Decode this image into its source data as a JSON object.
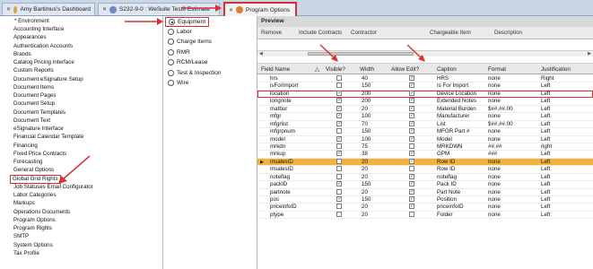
{
  "tabs": [
    {
      "label": "Amy Bartimus's Dashboard",
      "close": "✕",
      "icon": "dashboard-icon",
      "color": "#d9a441"
    },
    {
      "label": "S232-9-0 : WeSuite Test9 Estimate",
      "close": "✕",
      "icon": "estimate-icon",
      "color": "#6b8cc7"
    },
    {
      "label": "Program Options",
      "close": "✕",
      "icon": "gear-icon",
      "color": "#e07a2e"
    }
  ],
  "tree": {
    "root": "* Environment",
    "items": [
      "Accounting Interface",
      "Appearances",
      "Authentication Accounts",
      "Brands",
      "Catalog Pricing Interface",
      "Custom Reports",
      "Document eSignature Setup",
      "Document Items",
      "Document Pages",
      "Document Setup",
      "Document Templates",
      "Document Text",
      "eSignature Interface",
      "Financial Calendar Template",
      "Financing",
      "Fixed Price Contracts",
      "Forecasting",
      "General Options",
      "Global Grid Rights",
      "Job Statuses Email Configurator",
      "Labor Categories",
      "Markups",
      "Operations Documents",
      "Program Options",
      "Program Rights",
      "SMTP",
      "System Options",
      "Tax Profile"
    ]
  },
  "radios": [
    "Equipment",
    "Labor",
    "Charge Items",
    "RMR",
    "RCM/Lease",
    "Test & Inspection",
    "Wire"
  ],
  "preview": {
    "title": "Preview",
    "columns": [
      "Remove",
      "Include Contracts",
      "Contractor",
      "Chargeable Item",
      "Description"
    ]
  },
  "grid": {
    "columns": [
      "Field Name",
      "Visible?",
      "Width",
      "Allow Edit?",
      "Caption",
      "Format",
      "Justification"
    ],
    "sort_icon": "△",
    "rows": [
      {
        "field": "hrs",
        "visible": false,
        "width": "40",
        "edit": true,
        "caption": "HRS",
        "format": "none",
        "just": "Right"
      },
      {
        "field": "isForImport",
        "visible": false,
        "width": "150",
        "edit": true,
        "caption": "Is For Import",
        "format": "none",
        "just": "Left"
      },
      {
        "field": "location",
        "visible": true,
        "width": "200",
        "edit": true,
        "caption": "Device Location",
        "format": "none",
        "just": "Left"
      },
      {
        "field": "longnote",
        "visible": true,
        "width": "200",
        "edit": true,
        "caption": "Extended Notes",
        "format": "none",
        "just": "Left"
      },
      {
        "field": "matbur",
        "visible": true,
        "width": "20",
        "edit": true,
        "caption": "Material Burden",
        "format": "$##,##.00",
        "just": "Left"
      },
      {
        "field": "mfgr",
        "visible": true,
        "width": "100",
        "edit": true,
        "caption": "Manufacturer",
        "format": "none",
        "just": "Left"
      },
      {
        "field": "mfgrlist",
        "visible": true,
        "width": "70",
        "edit": true,
        "caption": "List",
        "format": "$##,##.00",
        "just": "Left"
      },
      {
        "field": "mfgrpnum",
        "visible": false,
        "width": "150",
        "edit": true,
        "caption": "MFGR Part #",
        "format": "none",
        "just": "Left"
      },
      {
        "field": "model",
        "visible": true,
        "width": "100",
        "edit": true,
        "caption": "Model",
        "format": "none",
        "just": "Left"
      },
      {
        "field": "mrkdn",
        "visible": false,
        "width": "75",
        "edit": false,
        "caption": "MRKDWN",
        "format": "##.##",
        "just": "right"
      },
      {
        "field": "mrkup",
        "visible": true,
        "width": "38",
        "edit": true,
        "caption": "GPM",
        "format": "###",
        "just": "Left"
      },
      {
        "field": "msalesID",
        "visible": false,
        "width": "20",
        "edit": true,
        "caption": "Row ID",
        "format": "none",
        "just": "Left"
      },
      {
        "field": "msalesID",
        "visible": false,
        "width": "20",
        "edit": false,
        "caption": "Row ID",
        "format": "none",
        "just": "Left"
      },
      {
        "field": "noteflag",
        "visible": false,
        "width": "20",
        "edit": true,
        "caption": "noteflag",
        "format": "none",
        "just": "Left"
      },
      {
        "field": "packID",
        "visible": true,
        "width": "150",
        "edit": true,
        "caption": "Pack ID",
        "format": "none",
        "just": "Left"
      },
      {
        "field": "partnote",
        "visible": false,
        "width": "20",
        "edit": true,
        "caption": "Part Note",
        "format": "none",
        "just": "Left"
      },
      {
        "field": "pos",
        "visible": true,
        "width": "150",
        "edit": true,
        "caption": "Position",
        "format": "none",
        "just": "Left"
      },
      {
        "field": "priceinfoID",
        "visible": false,
        "width": "20",
        "edit": true,
        "caption": "priceinfoID",
        "format": "none",
        "just": "Left"
      },
      {
        "field": "ptype",
        "visible": false,
        "width": "20",
        "edit": false,
        "caption": "Folder",
        "format": "none",
        "just": "Left"
      }
    ]
  },
  "colors": {
    "highlight": "#d63232",
    "selected_row": "#f5b23a",
    "check": "#2a5c9a"
  }
}
